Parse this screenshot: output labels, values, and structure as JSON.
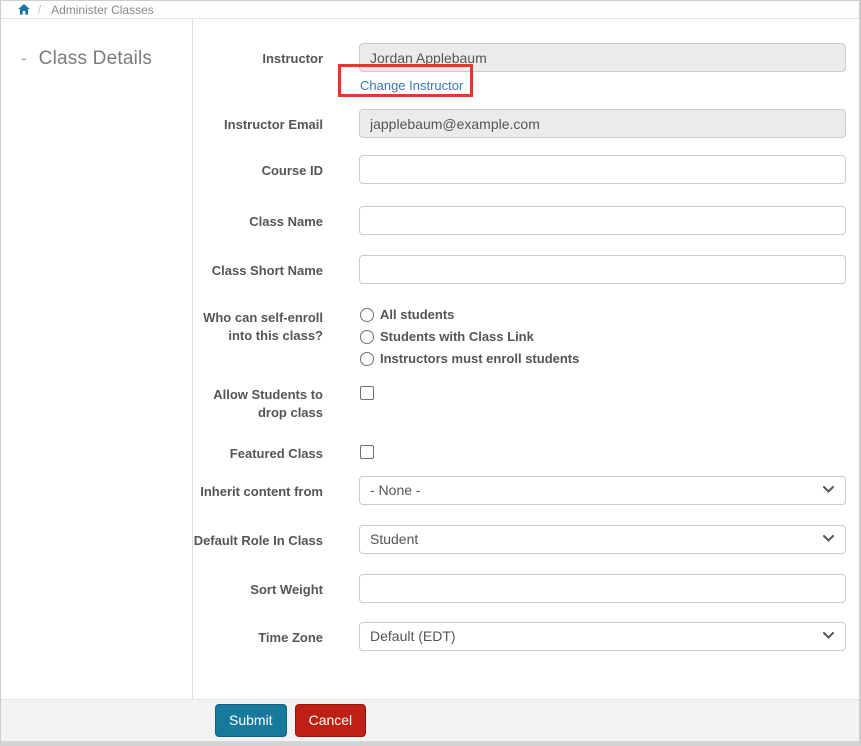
{
  "breadcrumb": {
    "home_icon": "home-icon",
    "separator": "/",
    "current": "Administer Classes"
  },
  "sidebar": {
    "collapse_indicator": "-",
    "section_title": "Class Details"
  },
  "form": {
    "instructor": {
      "label": "Instructor",
      "value": "Jordan Applebaum",
      "change_link_label": "Change Instructor",
      "highlight": "red-annotation-box"
    },
    "instructor_email": {
      "label": "Instructor Email",
      "value": "japplebaum@example.com"
    },
    "course_id": {
      "label": "Course ID",
      "value": ""
    },
    "class_name": {
      "label": "Class Name",
      "value": ""
    },
    "class_short_name": {
      "label": "Class Short Name",
      "value": ""
    },
    "self_enroll": {
      "label": "Who can self-enroll into this class?",
      "options": [
        {
          "label": "All students",
          "checked": false
        },
        {
          "label": "Students with Class Link",
          "checked": false
        },
        {
          "label": "Instructors must enroll students",
          "checked": false
        }
      ]
    },
    "allow_drop": {
      "label": "Allow Students to drop class",
      "checked": false
    },
    "featured_class": {
      "label": "Featured Class",
      "checked": false
    },
    "inherit_content": {
      "label": "Inherit content from",
      "selected": "- None -"
    },
    "default_role": {
      "label": "Default Role In Class",
      "selected": "Student"
    },
    "sort_weight": {
      "label": "Sort Weight",
      "value": ""
    },
    "time_zone": {
      "label": "Time Zone",
      "selected": "Default (EDT)"
    }
  },
  "footer": {
    "submit_label": "Submit",
    "cancel_label": "Cancel"
  },
  "colors": {
    "accent_teal": "#17799c",
    "cancel_red": "#bf2016",
    "link_blue": "#337ab7",
    "annotation_red": "#e03a2c",
    "label_gray": "#555555",
    "disabled_input_bg": "#ebebeb"
  }
}
